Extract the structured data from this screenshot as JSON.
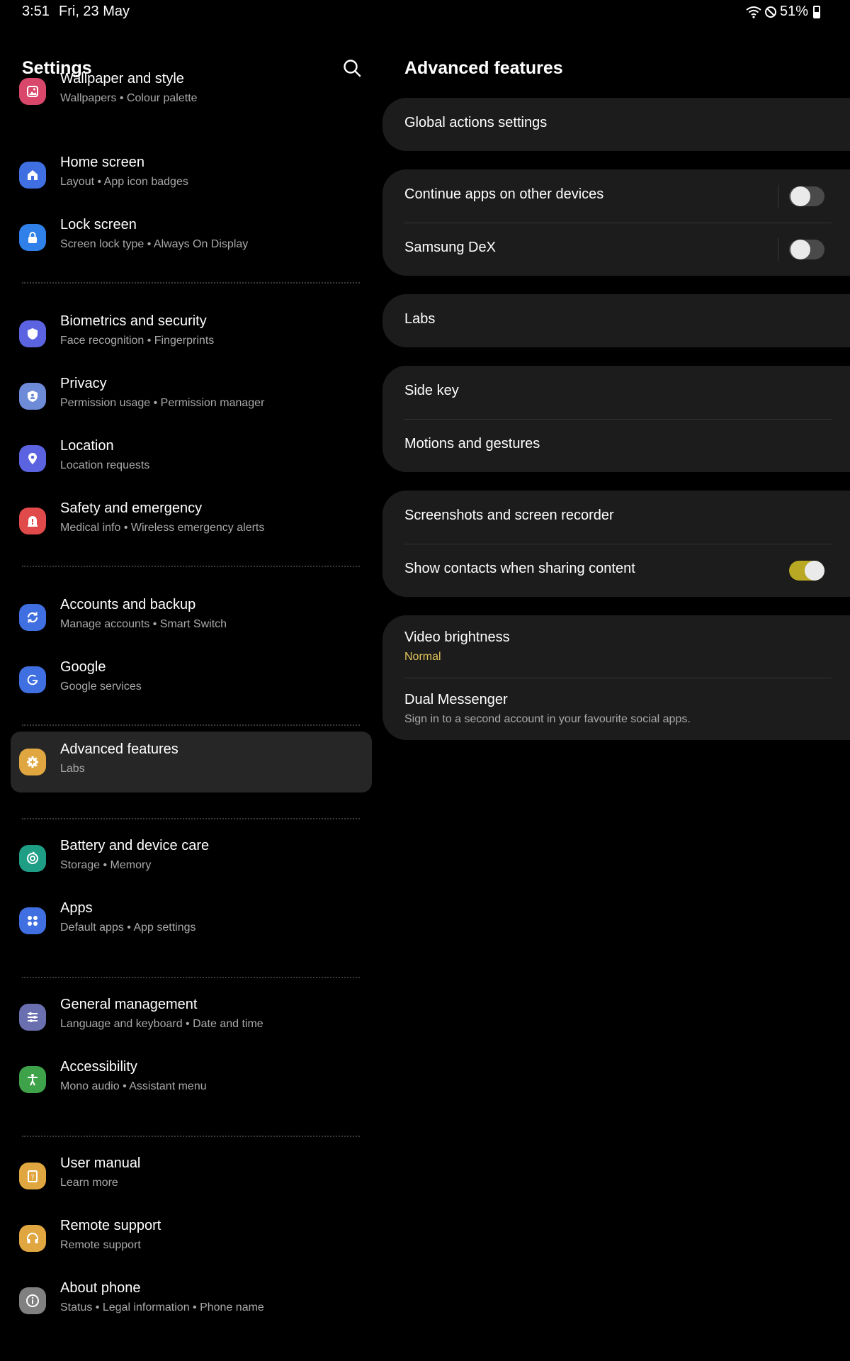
{
  "status": {
    "time": "3:51",
    "date": "Fri, 23 May",
    "battery": "51%",
    "icons": [
      "wifi-icon",
      "do-not-disturb-icon",
      "battery-icon"
    ]
  },
  "left": {
    "title": "Settings",
    "search_icon": "search-icon",
    "items": [
      {
        "title": "Wallpaper and style",
        "sub": "Wallpapers  •  Colour palette",
        "icon": "wallpaper-icon",
        "color": "#d9476b"
      },
      {
        "title": "Home screen",
        "sub": "Layout  •  App icon badges",
        "icon": "home-icon",
        "color": "#3f6fe0"
      },
      {
        "title": "Lock screen",
        "sub": "Screen lock type  •  Always On Display",
        "icon": "lock-icon",
        "color": "#2f80e8"
      },
      {
        "title": "Biometrics and security",
        "sub": "Face recognition  •  Fingerprints",
        "icon": "shield-icon",
        "color": "#5b63e0"
      },
      {
        "title": "Privacy",
        "sub": "Permission usage  •  Permission manager",
        "icon": "privacy-icon",
        "color": "#6e8bd8"
      },
      {
        "title": "Location",
        "sub": "Location requests",
        "icon": "location-pin-icon",
        "color": "#5b63e0"
      },
      {
        "title": "Safety and emergency",
        "sub": "Medical info  •  Wireless emergency alerts",
        "icon": "emergency-icon",
        "color": "#e04a4a"
      },
      {
        "title": "Accounts and backup",
        "sub": "Manage accounts  •  Smart Switch",
        "icon": "sync-icon",
        "color": "#3f6fe0"
      },
      {
        "title": "Google",
        "sub": "Google services",
        "icon": "google-icon",
        "color": "#3f6fe0"
      },
      {
        "title": "Advanced features",
        "sub": "Labs",
        "icon": "gear-plus-icon",
        "color": "#e0a640"
      },
      {
        "title": "Battery and device care",
        "sub": "Storage  •  Memory",
        "icon": "device-care-icon",
        "color": "#1f9e86"
      },
      {
        "title": "Apps",
        "sub": "Default apps  •  App settings",
        "icon": "apps-grid-icon",
        "color": "#3f6fe0"
      },
      {
        "title": "General management",
        "sub": "Language and keyboard  •  Date and time",
        "icon": "sliders-icon",
        "color": "#6a6fb0"
      },
      {
        "title": "Accessibility",
        "sub": "Mono audio  •  Assistant menu",
        "icon": "accessibility-icon",
        "color": "#3da24a"
      },
      {
        "title": "User manual",
        "sub": "Learn more",
        "icon": "manual-icon",
        "color": "#e0a640"
      },
      {
        "title": "Remote support",
        "sub": "Remote support",
        "icon": "headset-icon",
        "color": "#e0a640"
      },
      {
        "title": "About phone",
        "sub": "Status  •  Legal information  •  Phone name",
        "icon": "info-icon",
        "color": "#808080"
      }
    ]
  },
  "right": {
    "title": "Advanced features",
    "global_actions": "Global actions settings",
    "continue_apps": "Continue apps on other devices",
    "continue_apps_on": false,
    "samsung_dex": "Samsung DeX",
    "samsung_dex_on": false,
    "labs": "Labs",
    "side_key": "Side key",
    "motions": "Motions and gestures",
    "screenshots": "Screenshots and screen recorder",
    "show_contacts": "Show contacts when sharing content",
    "show_contacts_on": true,
    "video_brightness": "Video brightness",
    "video_brightness_value": "Normal",
    "dual_messenger": "Dual Messenger",
    "dual_messenger_sub": "Sign in to a second account in your favourite social apps."
  }
}
